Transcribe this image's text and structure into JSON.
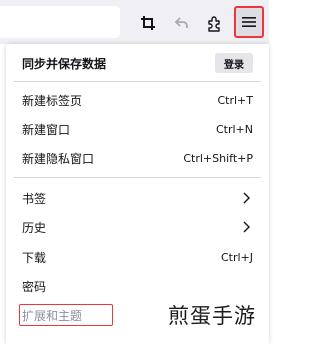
{
  "toolbar": {
    "icons": [
      "crop-icon",
      "undo-icon",
      "extensions-icon",
      "hamburger-menu-icon"
    ]
  },
  "menu": {
    "sync_title": "同步并保存数据",
    "login_label": "登录",
    "new_tab": {
      "label": "新建标签页",
      "shortcut": "Ctrl+T"
    },
    "new_window": {
      "label": "新建窗口",
      "shortcut": "Ctrl+N"
    },
    "new_private_window": {
      "label": "新建隐私窗口",
      "shortcut": "Ctrl+Shift+P"
    },
    "bookmarks": {
      "label": "书签"
    },
    "history": {
      "label": "历史"
    },
    "downloads": {
      "label": "下载",
      "shortcut": "Ctrl+J"
    },
    "passwords": {
      "label": "密码"
    },
    "addons": {
      "label": "扩展和主题"
    }
  },
  "watermark": "煎蛋手游",
  "colors": {
    "highlight": "#e8383d",
    "toolbar_bg": "#f0f0f4",
    "panel_bg": "#ffffff"
  }
}
